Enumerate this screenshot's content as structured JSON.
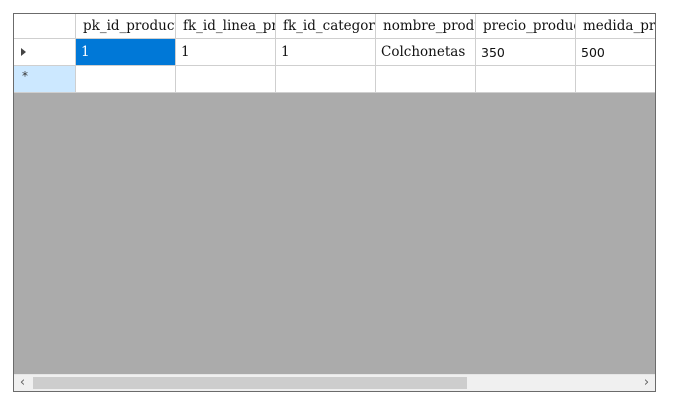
{
  "grid": {
    "columns": [
      "pk_id_producto",
      "fk_id_linea_producto",
      "fk_id_categoria",
      "nombre_producto",
      "precio_producto",
      "medida_producto"
    ],
    "row1": [
      "1",
      "1",
      "1",
      "Colchonetas",
      "350",
      "500"
    ],
    "new_row_marker": "*"
  },
  "scrollbar": {
    "left_arrow": "‹",
    "right_arrow": "›",
    "position_fraction": 0.0,
    "visible_fraction": 0.72
  },
  "colors": {
    "selection": "#0078d7",
    "empty_area": "#ababab",
    "new_row_header": "#cce8ff"
  }
}
